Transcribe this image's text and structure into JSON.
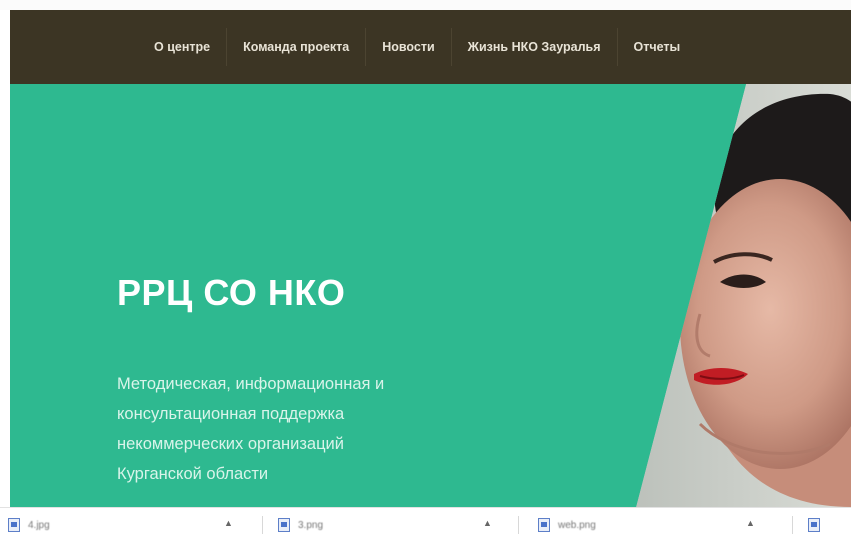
{
  "nav": {
    "items": [
      {
        "label": "О центре"
      },
      {
        "label": "Команда проекта"
      },
      {
        "label": "Новости"
      },
      {
        "label": "Жизнь НКО Зауралья"
      },
      {
        "label": "Отчеты"
      }
    ]
  },
  "hero": {
    "title": "РРЦ СО НКО",
    "description_lines": [
      "Методическая, информационная и",
      "консультационная поддержка",
      "некоммерческих организаций",
      "Курганской области"
    ]
  },
  "downloads": {
    "items": [
      {
        "name": "4.jpg"
      },
      {
        "name": "3.png"
      },
      {
        "name": "web.png"
      },
      {
        "name": ""
      }
    ]
  },
  "colors": {
    "nav_bg": "#3c3524",
    "hero_green": "#2eb990",
    "nav_text": "#e8e3d6"
  }
}
